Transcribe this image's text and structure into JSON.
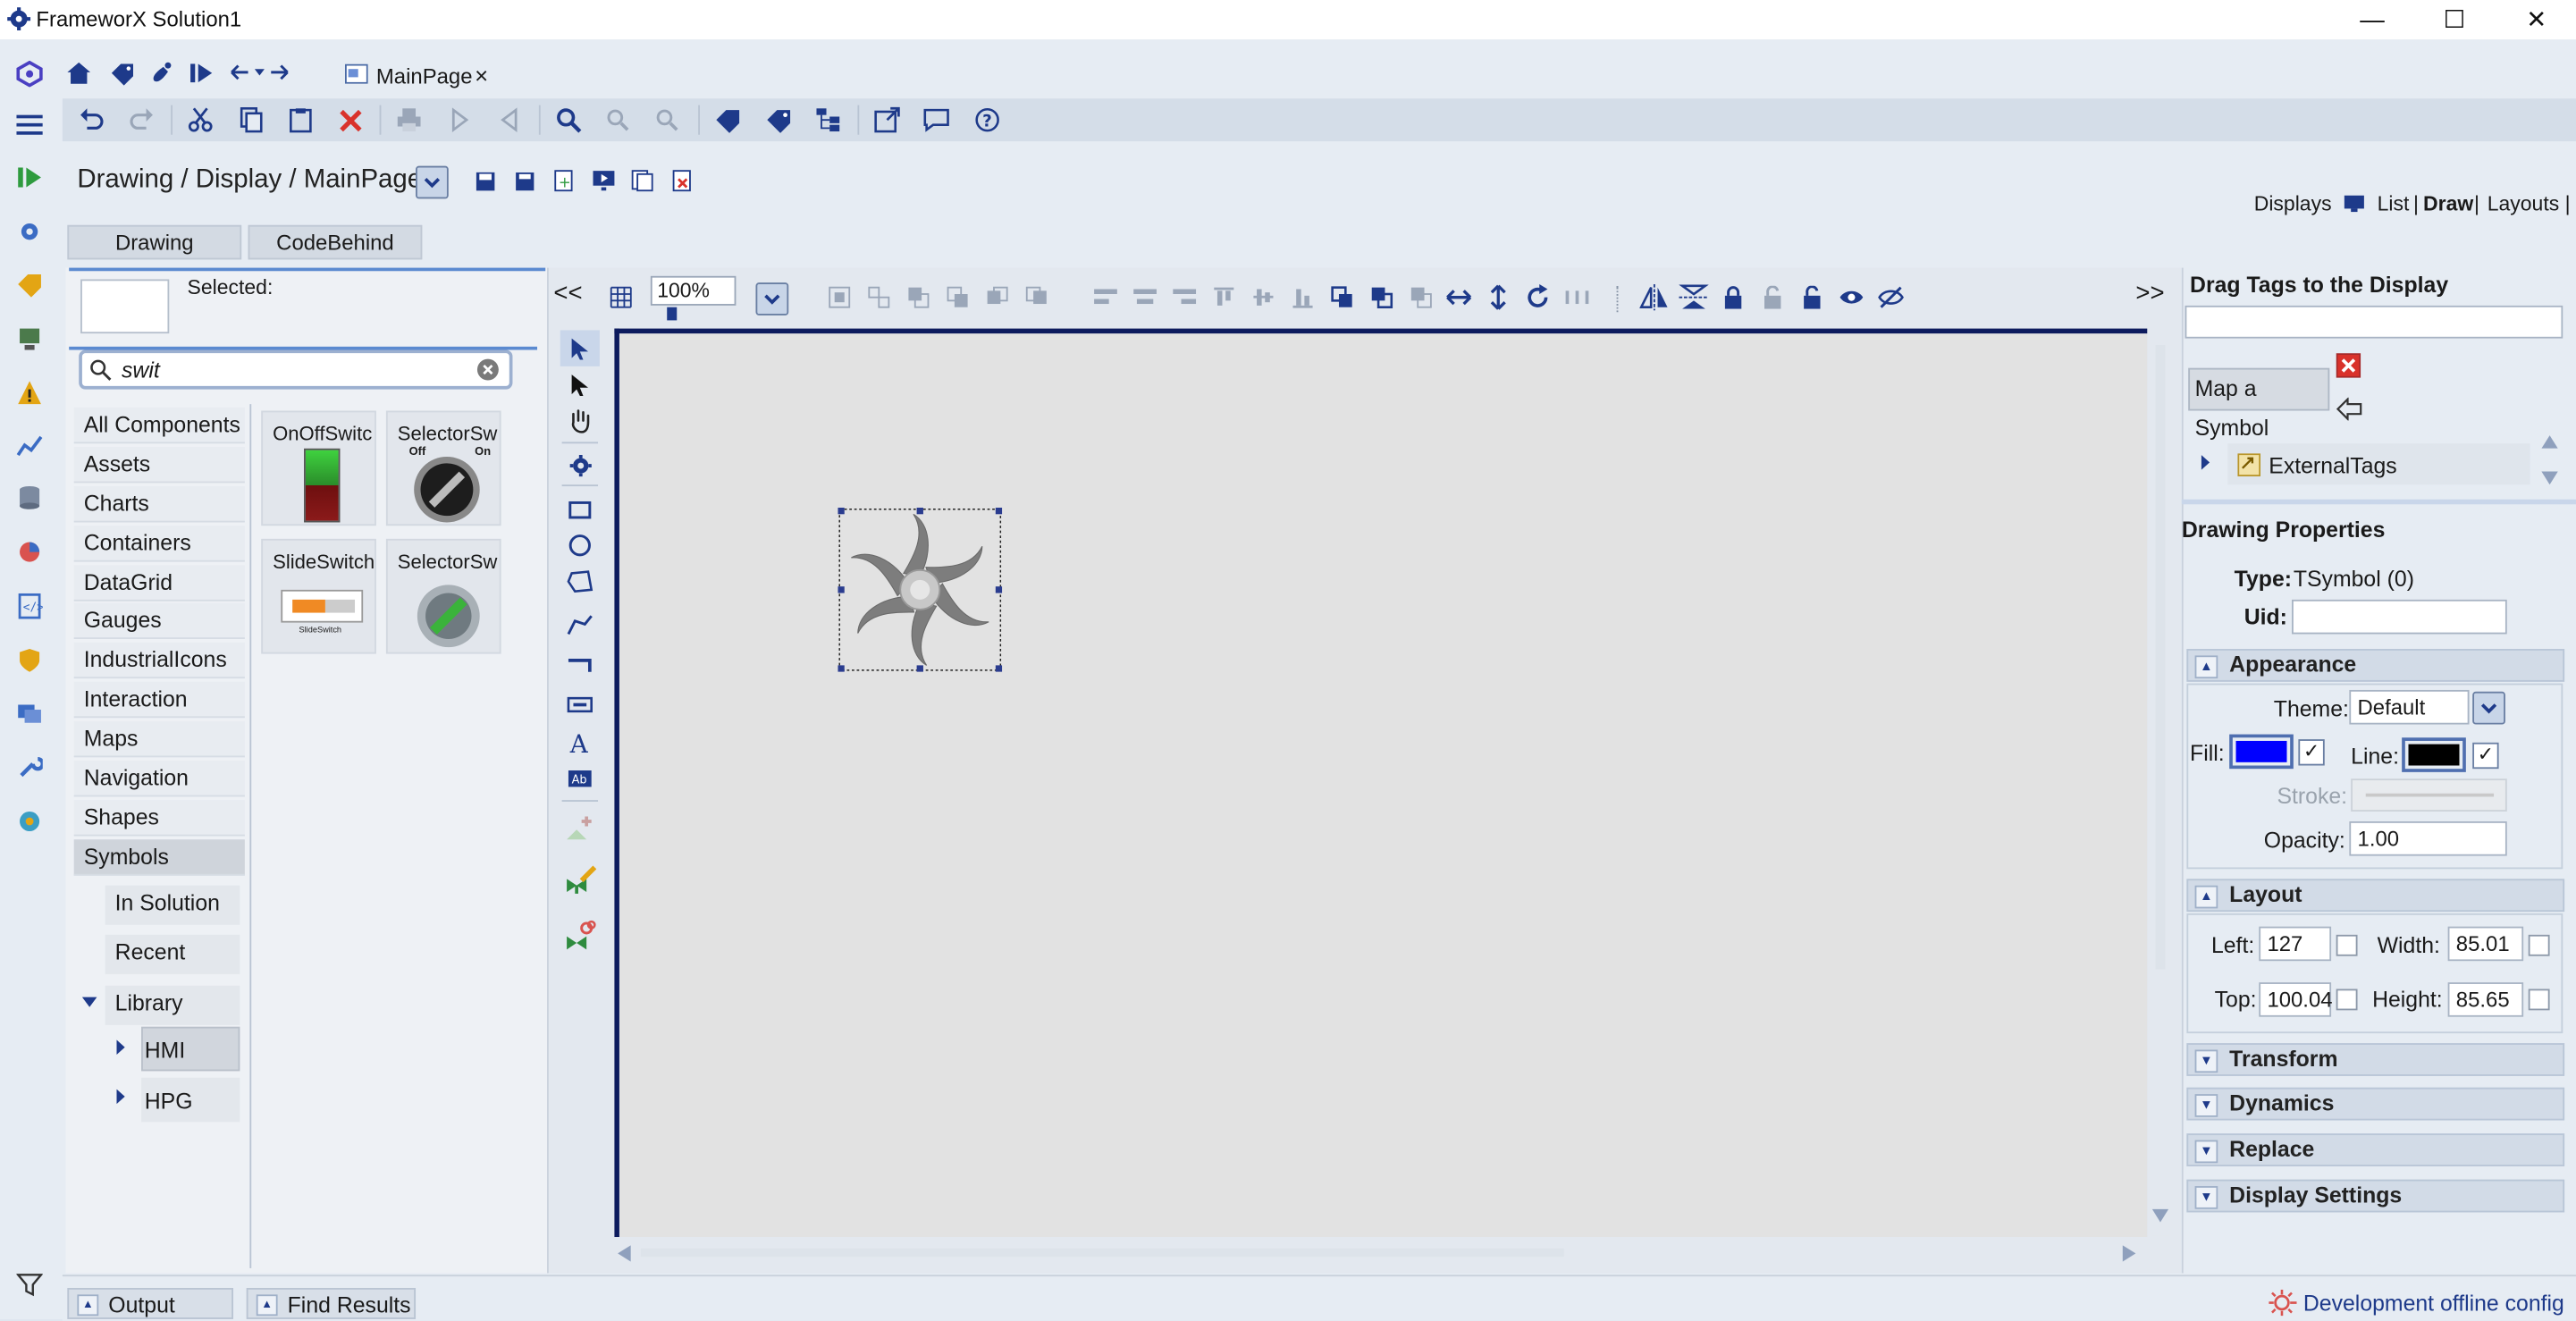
{
  "window": {
    "title": "FrameworX Solution1",
    "minimize": "—",
    "maximize": "☐",
    "close": "✕"
  },
  "doc_tab": {
    "label": "MainPage",
    "close": "×"
  },
  "breadcrumb": "Drawing / Display / MainPage",
  "subtabs": [
    "Drawing",
    "CodeBehind"
  ],
  "displays_nav": {
    "label": "Displays",
    "list": "List",
    "sep": "|",
    "draw": "Draw",
    "layouts": "Layouts |"
  },
  "components": {
    "selected_label": "Selected:",
    "search_value": "swit",
    "categories": [
      "All Components",
      "Assets",
      "Charts",
      "Containers",
      "DataGrid",
      "Gauges",
      "IndustrialIcons",
      "Interaction",
      "Maps",
      "Navigation",
      "Shapes",
      "Symbols"
    ],
    "subcategories": [
      "In Solution",
      "Recent",
      "Library",
      "HMI",
      "HPG"
    ],
    "results": [
      "OnOffSwitc",
      "SelectorSw",
      "SlideSwitch",
      "SelectorSw"
    ],
    "selector_off": "Off",
    "selector_on": "On",
    "slide_caption": "SlideSwitch"
  },
  "canvas": {
    "collapse_left": "<<",
    "collapse_right": ">>",
    "zoom": "100%"
  },
  "tags": {
    "title": "Drag Tags to the Display",
    "map_symbol": "Map a Symbol",
    "external_tags": "ExternalTags"
  },
  "properties": {
    "title": "Drawing Properties",
    "type_label": "Type:",
    "type_value": "TSymbol (0)",
    "uid_label": "Uid:",
    "uid_value": "",
    "appearance": "Appearance",
    "theme_label": "Theme:",
    "theme_value": "Default",
    "fill_label": "Fill:",
    "fill_color": "#0000ff",
    "line_label": "Line:",
    "line_color": "#000000",
    "stroke_label": "Stroke:",
    "opacity_label": "Opacity:",
    "opacity_value": "1.00",
    "layout": "Layout",
    "left_label": "Left:",
    "left_value": "127",
    "top_label": "Top:",
    "top_value": "100.04",
    "width_label": "Width:",
    "width_value": "85.01",
    "height_label": "Height:",
    "height_value": "85.65",
    "transform": "Transform",
    "dynamics": "Dynamics",
    "replace": "Replace",
    "display_settings": "Display Settings"
  },
  "bottom": {
    "output": "Output",
    "find_results": "Find Results",
    "status": "Development offline config"
  },
  "colors": {
    "accent": "#1e3a8a",
    "canvas_border": "#0d1b5e",
    "fan": "#7d7d7d"
  },
  "icons": [
    "gear-icon",
    "home-icon",
    "tag-icon",
    "brush-icon",
    "run-icon",
    "undo-icon",
    "redo-icon",
    "cut-icon",
    "copy-icon",
    "paste-icon",
    "delete-icon",
    "search-icon",
    "help-icon",
    "fan-symbol"
  ]
}
